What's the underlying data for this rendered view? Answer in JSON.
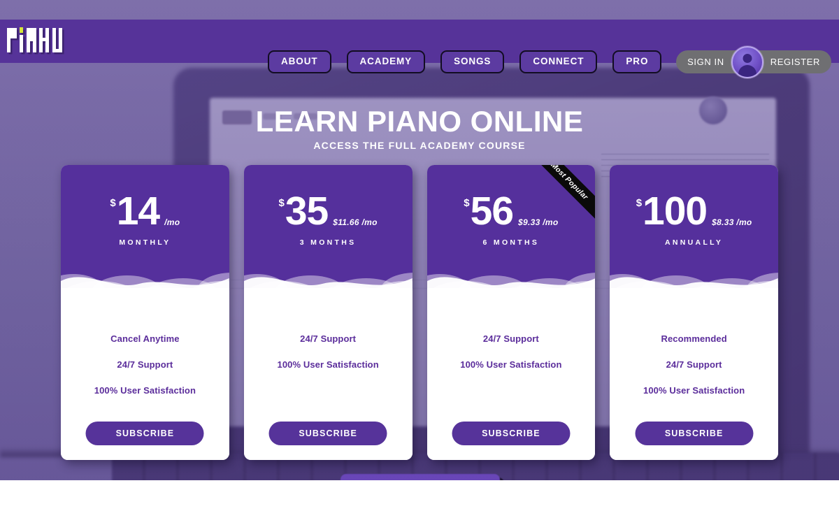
{
  "brand": {
    "logo_text": "PiANU",
    "logo_dot_color": "#d7e83a",
    "nav_bar_color": "#563399"
  },
  "nav": {
    "items": [
      {
        "label": "ABOUT"
      },
      {
        "label": "ACADEMY"
      },
      {
        "label": "SONGS"
      },
      {
        "label": "CONNECT"
      },
      {
        "label": "PRO"
      }
    ],
    "sign_in_label": "SIGN IN",
    "register_label": "REGISTER"
  },
  "hero": {
    "title": "LEARN PIANO ONLINE",
    "subtitle": "ACCESS THE FULL ACADEMY COURSE"
  },
  "pricing": {
    "ribbon_label": "Most Popular",
    "card_header_color": "#55309C",
    "feature_text_color": "#5B2D9B",
    "subscribe_color": "#56339A",
    "cards": [
      {
        "currency": "$",
        "amount": "14",
        "per_month": "/mo",
        "period": "MONTHLY",
        "features": [
          "Cancel Anytime",
          "24/7 Support",
          "100% User Satisfaction"
        ],
        "cta": "SUBSCRIBE",
        "ribbon": false
      },
      {
        "currency": "$",
        "amount": "35",
        "per_month": "$11.66 /mo",
        "period": "3 MONTHS",
        "features": [
          "24/7 Support",
          "100% User Satisfaction"
        ],
        "cta": "SUBSCRIBE",
        "ribbon": false
      },
      {
        "currency": "$",
        "amount": "56",
        "per_month": "$9.33 /mo",
        "period": "6 MONTHS",
        "features": [
          "24/7 Support",
          "100% User Satisfaction"
        ],
        "cta": "SUBSCRIBE",
        "ribbon": true
      },
      {
        "currency": "$",
        "amount": "100",
        "per_month": "$8.33 /mo",
        "period": "ANNUALLY",
        "features": [
          "Recommended",
          "24/7 Support",
          "100% User Satisfaction"
        ],
        "cta": "SUBSCRIBE",
        "ribbon": false
      }
    ]
  }
}
